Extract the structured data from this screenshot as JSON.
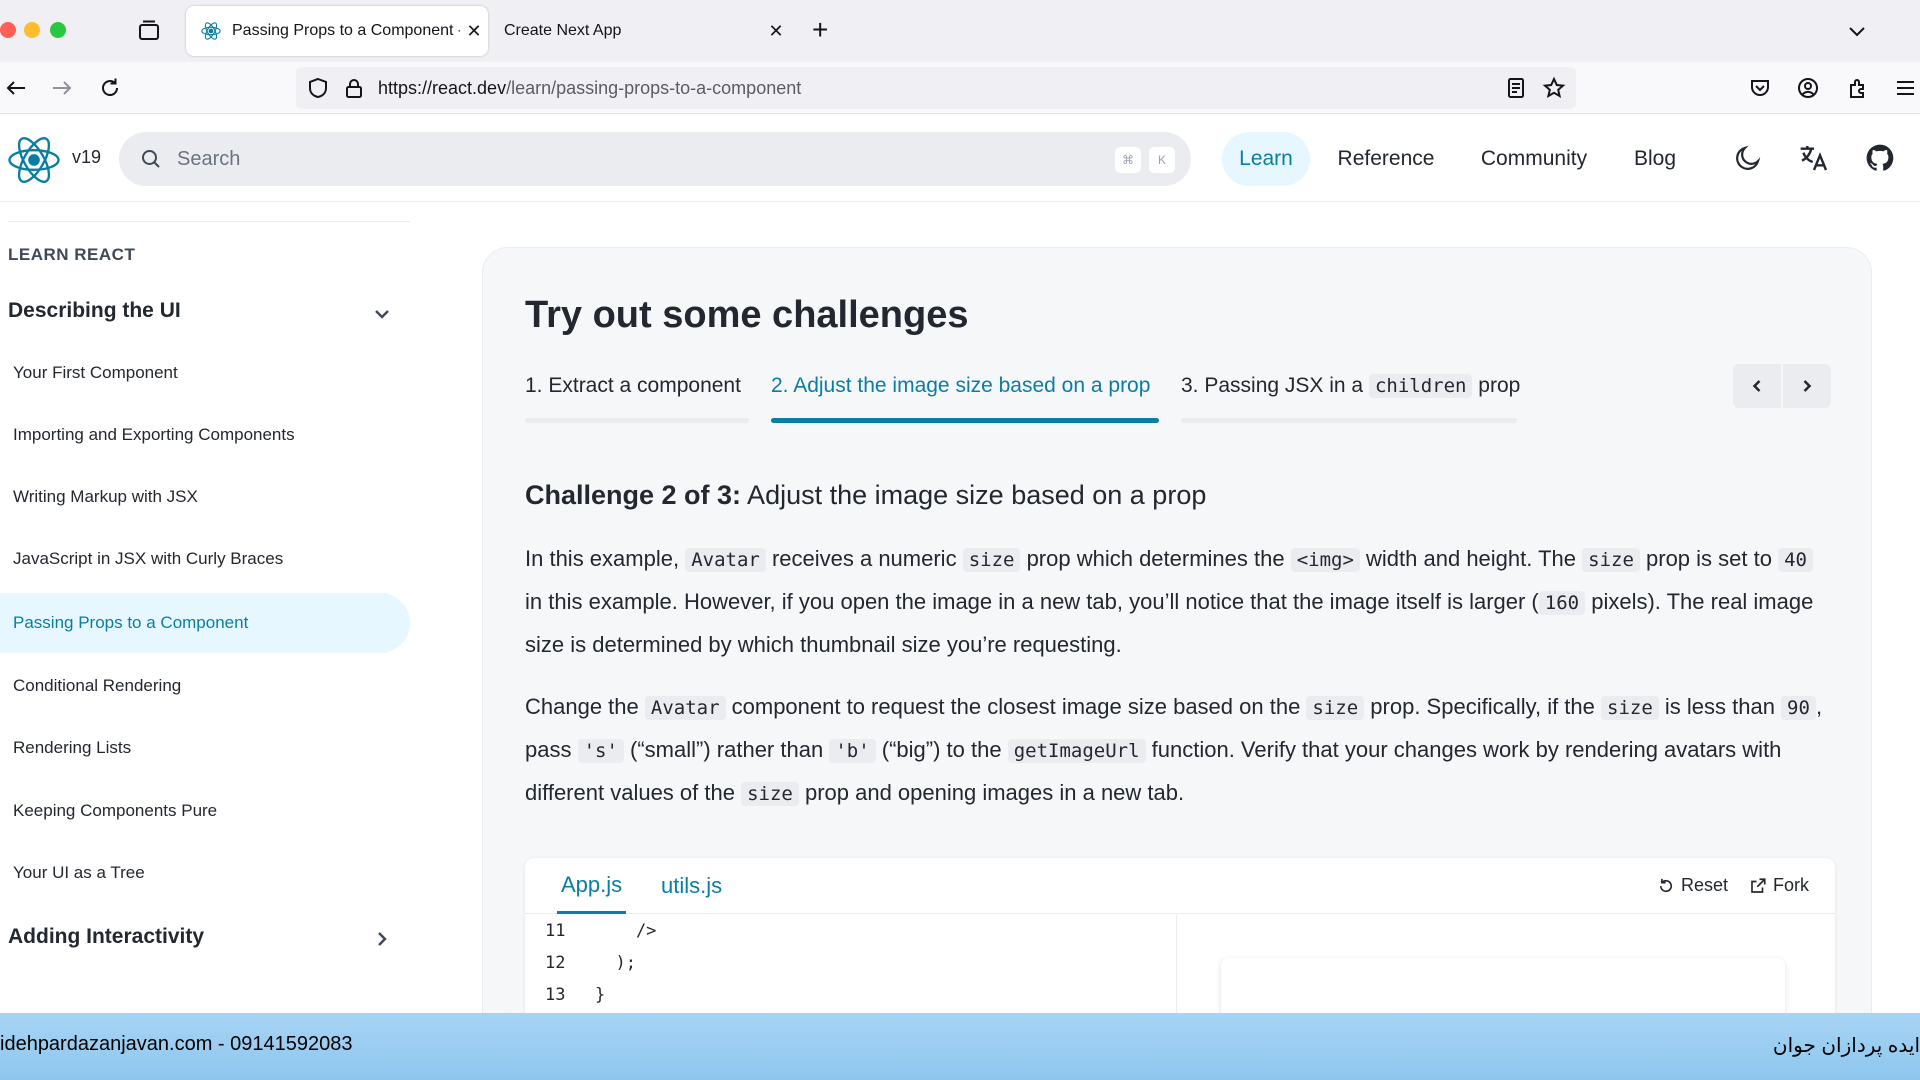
{
  "browser": {
    "tabs": [
      {
        "label": "Passing Props to a Component - ",
        "close": "✕"
      },
      {
        "label": "Create Next App",
        "close": "✕"
      }
    ],
    "new_tab": "+",
    "url_domain": "https://react.dev",
    "url_path": "/learn/passing-props-to-a-component"
  },
  "header": {
    "version": "v19",
    "search_placeholder": "Search",
    "shortcut_keys": [
      "⌘",
      "K"
    ],
    "nav": [
      "Learn",
      "Reference",
      "Community",
      "Blog"
    ]
  },
  "sidebar": {
    "heading": "LEARN REACT",
    "section1": "Describing the UI",
    "items": [
      "Your First Component",
      "Importing and Exporting Components",
      "Writing Markup with JSX",
      "JavaScript in JSX with Curly Braces",
      "Passing Props to a Component",
      "Conditional Rendering",
      "Rendering Lists",
      "Keeping Components Pure",
      "Your UI as a Tree"
    ],
    "section2": "Adding Interactivity"
  },
  "challenge": {
    "title": "Try out some challenges",
    "tabs": [
      {
        "prefix": "1. Extract a component"
      },
      {
        "prefix": "2. Adjust the image size based on a prop"
      },
      {
        "prefix": "3. Passing JSX in a ",
        "code": "children",
        "suffix": " prop"
      }
    ],
    "heading_bold": "Challenge 2 of 3:",
    "heading_rest": " Adjust the image size based on a prop",
    "p1": {
      "t1": "In this example, ",
      "c1": "Avatar",
      "t2": " receives a numeric ",
      "c2": "size",
      "t3": " prop which determines the ",
      "c3": "<img>",
      "t4": " width and height. The ",
      "c4": "size",
      "t5": " prop is set to ",
      "c5": "40",
      "t6": " in this example. However, if you open the image in a new tab, you’ll notice that the image itself is larger (",
      "c6": "160",
      "t7": " pixels). The real image size is determined by which thumbnail size you’re requesting."
    },
    "p2": {
      "t1": "Change the ",
      "c1": "Avatar",
      "t2": " component to request the closest image size based on the ",
      "c2": "size",
      "t3": " prop. Specifically, if the ",
      "c3": "size",
      "t4": " is less than ",
      "c4": "90",
      "t5": ", pass ",
      "c5": "'s'",
      "t6": " (“small”) rather than ",
      "c6": "'b'",
      "t7": " (“big”) to the ",
      "c7": "getImageUrl",
      "t8": " function. Verify that your changes work by rendering avatars with different values of the ",
      "c8": "size",
      "t9": " prop and opening images in a new tab."
    }
  },
  "sandpack": {
    "files": [
      "App.js",
      "utils.js"
    ],
    "reset": "Reset",
    "fork": "Fork",
    "code": [
      {
        "n": "11",
        "text": "    />"
      },
      {
        "n": "12",
        "text": "  );"
      },
      {
        "n": "13",
        "text": "}"
      }
    ]
  },
  "watermark": {
    "left": "idehpardazanjavan.com - 09141592083",
    "right": "ایده پردازان جوان"
  },
  "colors": {
    "accent": "#087ea4",
    "accent_bg": "#e6f7ff",
    "watermark": "#a7d4f5"
  }
}
